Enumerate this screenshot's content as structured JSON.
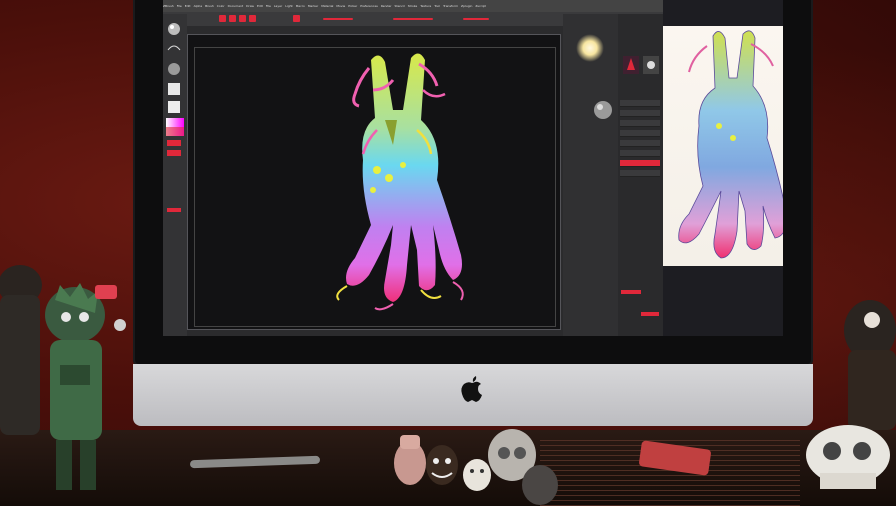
{
  "scene": {
    "description_free": true,
    "monitor_brand_icon": "apple-logo-icon",
    "app_menu_items": [
      "ZBrush",
      "File",
      "Edit",
      "Alpha",
      "Brush",
      "Color",
      "Document",
      "Draw",
      "Edit",
      "File",
      "Layer",
      "Light",
      "Macro",
      "Marker",
      "Material",
      "Movie",
      "Picker",
      "Preferences",
      "Render",
      "Stencil",
      "Stroke",
      "Texture",
      "Tool",
      "Transform",
      "Zplugin",
      "Zscript"
    ],
    "colors": {
      "wall": "#4a0f0a",
      "accent_red": "#e0283a",
      "figure_yellow": "#d8e84a",
      "figure_cyan": "#6ad8f0",
      "figure_magenta": "#e070e8",
      "figure_pink": "#f0307a"
    }
  }
}
